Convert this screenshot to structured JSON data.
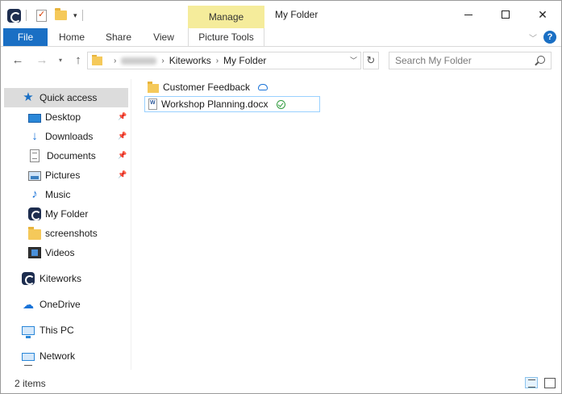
{
  "window": {
    "title": "My Folder",
    "contextual_tab": "Manage",
    "controls": {
      "minimize": "",
      "maximize": "",
      "close": "✕"
    }
  },
  "ribbon": {
    "tabs": [
      {
        "label": "File"
      },
      {
        "label": "Home"
      },
      {
        "label": "Share"
      },
      {
        "label": "View"
      },
      {
        "label": "Picture Tools"
      }
    ],
    "help": "?"
  },
  "navigation": {
    "back": "←",
    "forward": "→",
    "recent": "▾",
    "up": "↑",
    "breadcrumbs": [
      "username",
      "Kiteworks",
      "My Folder"
    ],
    "refresh": "↻",
    "search_placeholder": "Search My Folder"
  },
  "nav_pane": {
    "quick_access": "Quick access",
    "pinned": [
      {
        "label": "Desktop",
        "icon": "desktop-icon",
        "pinned": true
      },
      {
        "label": "Downloads",
        "icon": "download-icon",
        "pinned": true
      },
      {
        "label": "Documents",
        "icon": "documents-icon",
        "pinned": true
      },
      {
        "label": "Pictures",
        "icon": "pictures-icon",
        "pinned": true
      },
      {
        "label": "Music",
        "icon": "music-icon",
        "pinned": false
      },
      {
        "label": "My Folder",
        "icon": "kiteworks-icon",
        "pinned": false
      },
      {
        "label": "screenshots",
        "icon": "folder-icon",
        "pinned": false
      },
      {
        "label": "Videos",
        "icon": "videos-icon",
        "pinned": false
      }
    ],
    "roots": [
      {
        "label": "Kiteworks",
        "icon": "kiteworks-icon"
      },
      {
        "label": "OneDrive",
        "icon": "cloud-icon"
      },
      {
        "label": "This PC",
        "icon": "computer-icon"
      },
      {
        "label": "Network",
        "icon": "network-icon"
      }
    ]
  },
  "content": {
    "items": [
      {
        "name": "Customer Feedback",
        "type": "folder",
        "sync_status": "cloud"
      },
      {
        "name": "Workshop Planning.docx",
        "type": "document",
        "sync_status": "synced"
      }
    ]
  },
  "status_bar": {
    "item_count": "2 items"
  },
  "colors": {
    "accent": "#1a6fc4",
    "manage_tab": "#f5ec9b",
    "selection": "#dcdcdc"
  }
}
